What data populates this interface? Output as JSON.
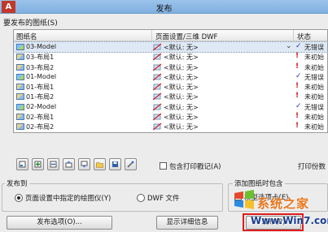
{
  "window": {
    "title": "发布",
    "app_glyph": "A"
  },
  "sheets_section": {
    "label": "要发布的图纸(S)"
  },
  "list": {
    "columns": [
      "图纸名",
      "页面设置/三维 DWF",
      "状态"
    ],
    "rows": [
      {
        "name": "03-Model",
        "type": "model",
        "setup": "<默认: 无>",
        "status": "无错误",
        "status_kind": "check",
        "selected": true
      },
      {
        "name": "03-布局1",
        "type": "layout",
        "setup": "<默认: 无>",
        "status": "未初始",
        "status_kind": "warn",
        "selected": false
      },
      {
        "name": "03-布局2",
        "type": "layout",
        "setup": "<默认: 无>",
        "status": "未初始",
        "status_kind": "warn",
        "selected": false
      },
      {
        "name": "01-Model",
        "type": "model",
        "setup": "<默认: 无>",
        "status": "无错误",
        "status_kind": "check",
        "selected": false
      },
      {
        "name": "01-布局1",
        "type": "layout",
        "setup": "<默认: 无>",
        "status": "未初始",
        "status_kind": "warn",
        "selected": false
      },
      {
        "name": "01-布局2",
        "type": "layout",
        "setup": "<默认: 无>",
        "status": "未初始",
        "status_kind": "warn",
        "selected": false
      },
      {
        "name": "02-Model",
        "type": "model",
        "setup": "<默认: 无>",
        "status": "无错误",
        "status_kind": "check",
        "selected": false
      },
      {
        "name": "02-布局1",
        "type": "layout",
        "setup": "<默认: 无>",
        "status": "未初始",
        "status_kind": "warn",
        "selected": false
      },
      {
        "name": "02-布局2",
        "type": "layout",
        "setup": "<默认: 无>",
        "status": "未初始",
        "status_kind": "warn",
        "selected": false
      }
    ]
  },
  "toolbar": {
    "icons": [
      "preview-sheet-icon",
      "add-sheets-icon",
      "remove-sheets-icon",
      "move-up-icon",
      "move-down-icon",
      "load-list-icon",
      "save-list-icon",
      "plot-stamp-settings-icon"
    ],
    "include_stamp_label": "包含打印戳记(A)",
    "include_stamp_checked": false,
    "copies_label": "打印份数"
  },
  "publish_to": {
    "label": "发布到",
    "option_page_setup": "页面设置中指定的绘图仪(Y)",
    "option_dwf": "DWF 文件"
  },
  "add_sheets": {
    "label": "添加图纸时包含",
    "model_tab_label": "模型选项卡(E)",
    "model_tab_checked": true
  },
  "buttons": {
    "publish_options": "发布选项(O)...",
    "show_details": "显示详细信息",
    "publish": "发布(P)"
  },
  "watermark": {
    "brand": "系统之家",
    "url": "Www.Win7.com"
  },
  "colors": {
    "titlebar": "#8fbbe8",
    "selection": "#dfe9f5",
    "highlight_box": "#e01b1b",
    "warn": "#d11a1a",
    "ok": "#1f3fae"
  }
}
